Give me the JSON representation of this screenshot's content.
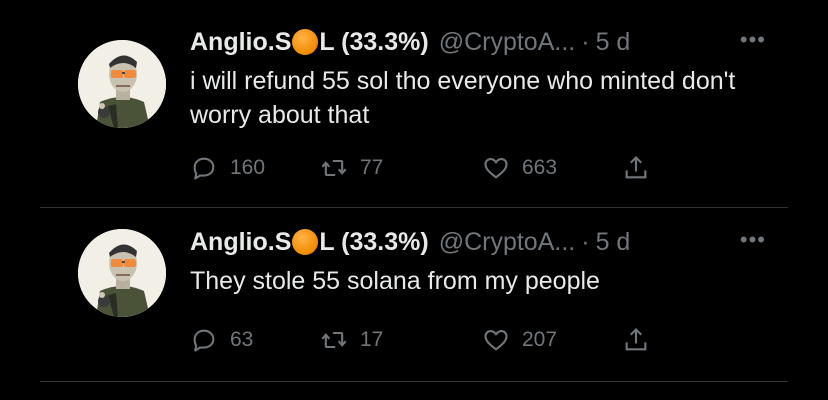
{
  "tweets": [
    {
      "name_prefix": "Anglio.S",
      "name_suffix": "L (33.3%)",
      "handle": "@CryptoA...",
      "separator": "·",
      "time": "5 d",
      "text": "i will refund 55 sol tho everyone who minted don't worry about that",
      "replies": "160",
      "retweets": "77",
      "likes": "663"
    },
    {
      "name_prefix": "Anglio.S",
      "name_suffix": "L (33.3%)",
      "handle": "@CryptoA...",
      "separator": "·",
      "time": "5 d",
      "text": "They stole 55 solana from my people",
      "replies": "63",
      "retweets": "17",
      "likes": "207"
    }
  ],
  "icons": {
    "more": "more-icon",
    "reply": "reply-icon",
    "retweet": "retweet-icon",
    "like": "heart-icon",
    "share": "share-icon",
    "coin": "orange-circle-emoji"
  },
  "colors": {
    "background": "#000000",
    "text": "#e7e9ea",
    "muted": "#71767b",
    "coin": "#f08a00"
  }
}
